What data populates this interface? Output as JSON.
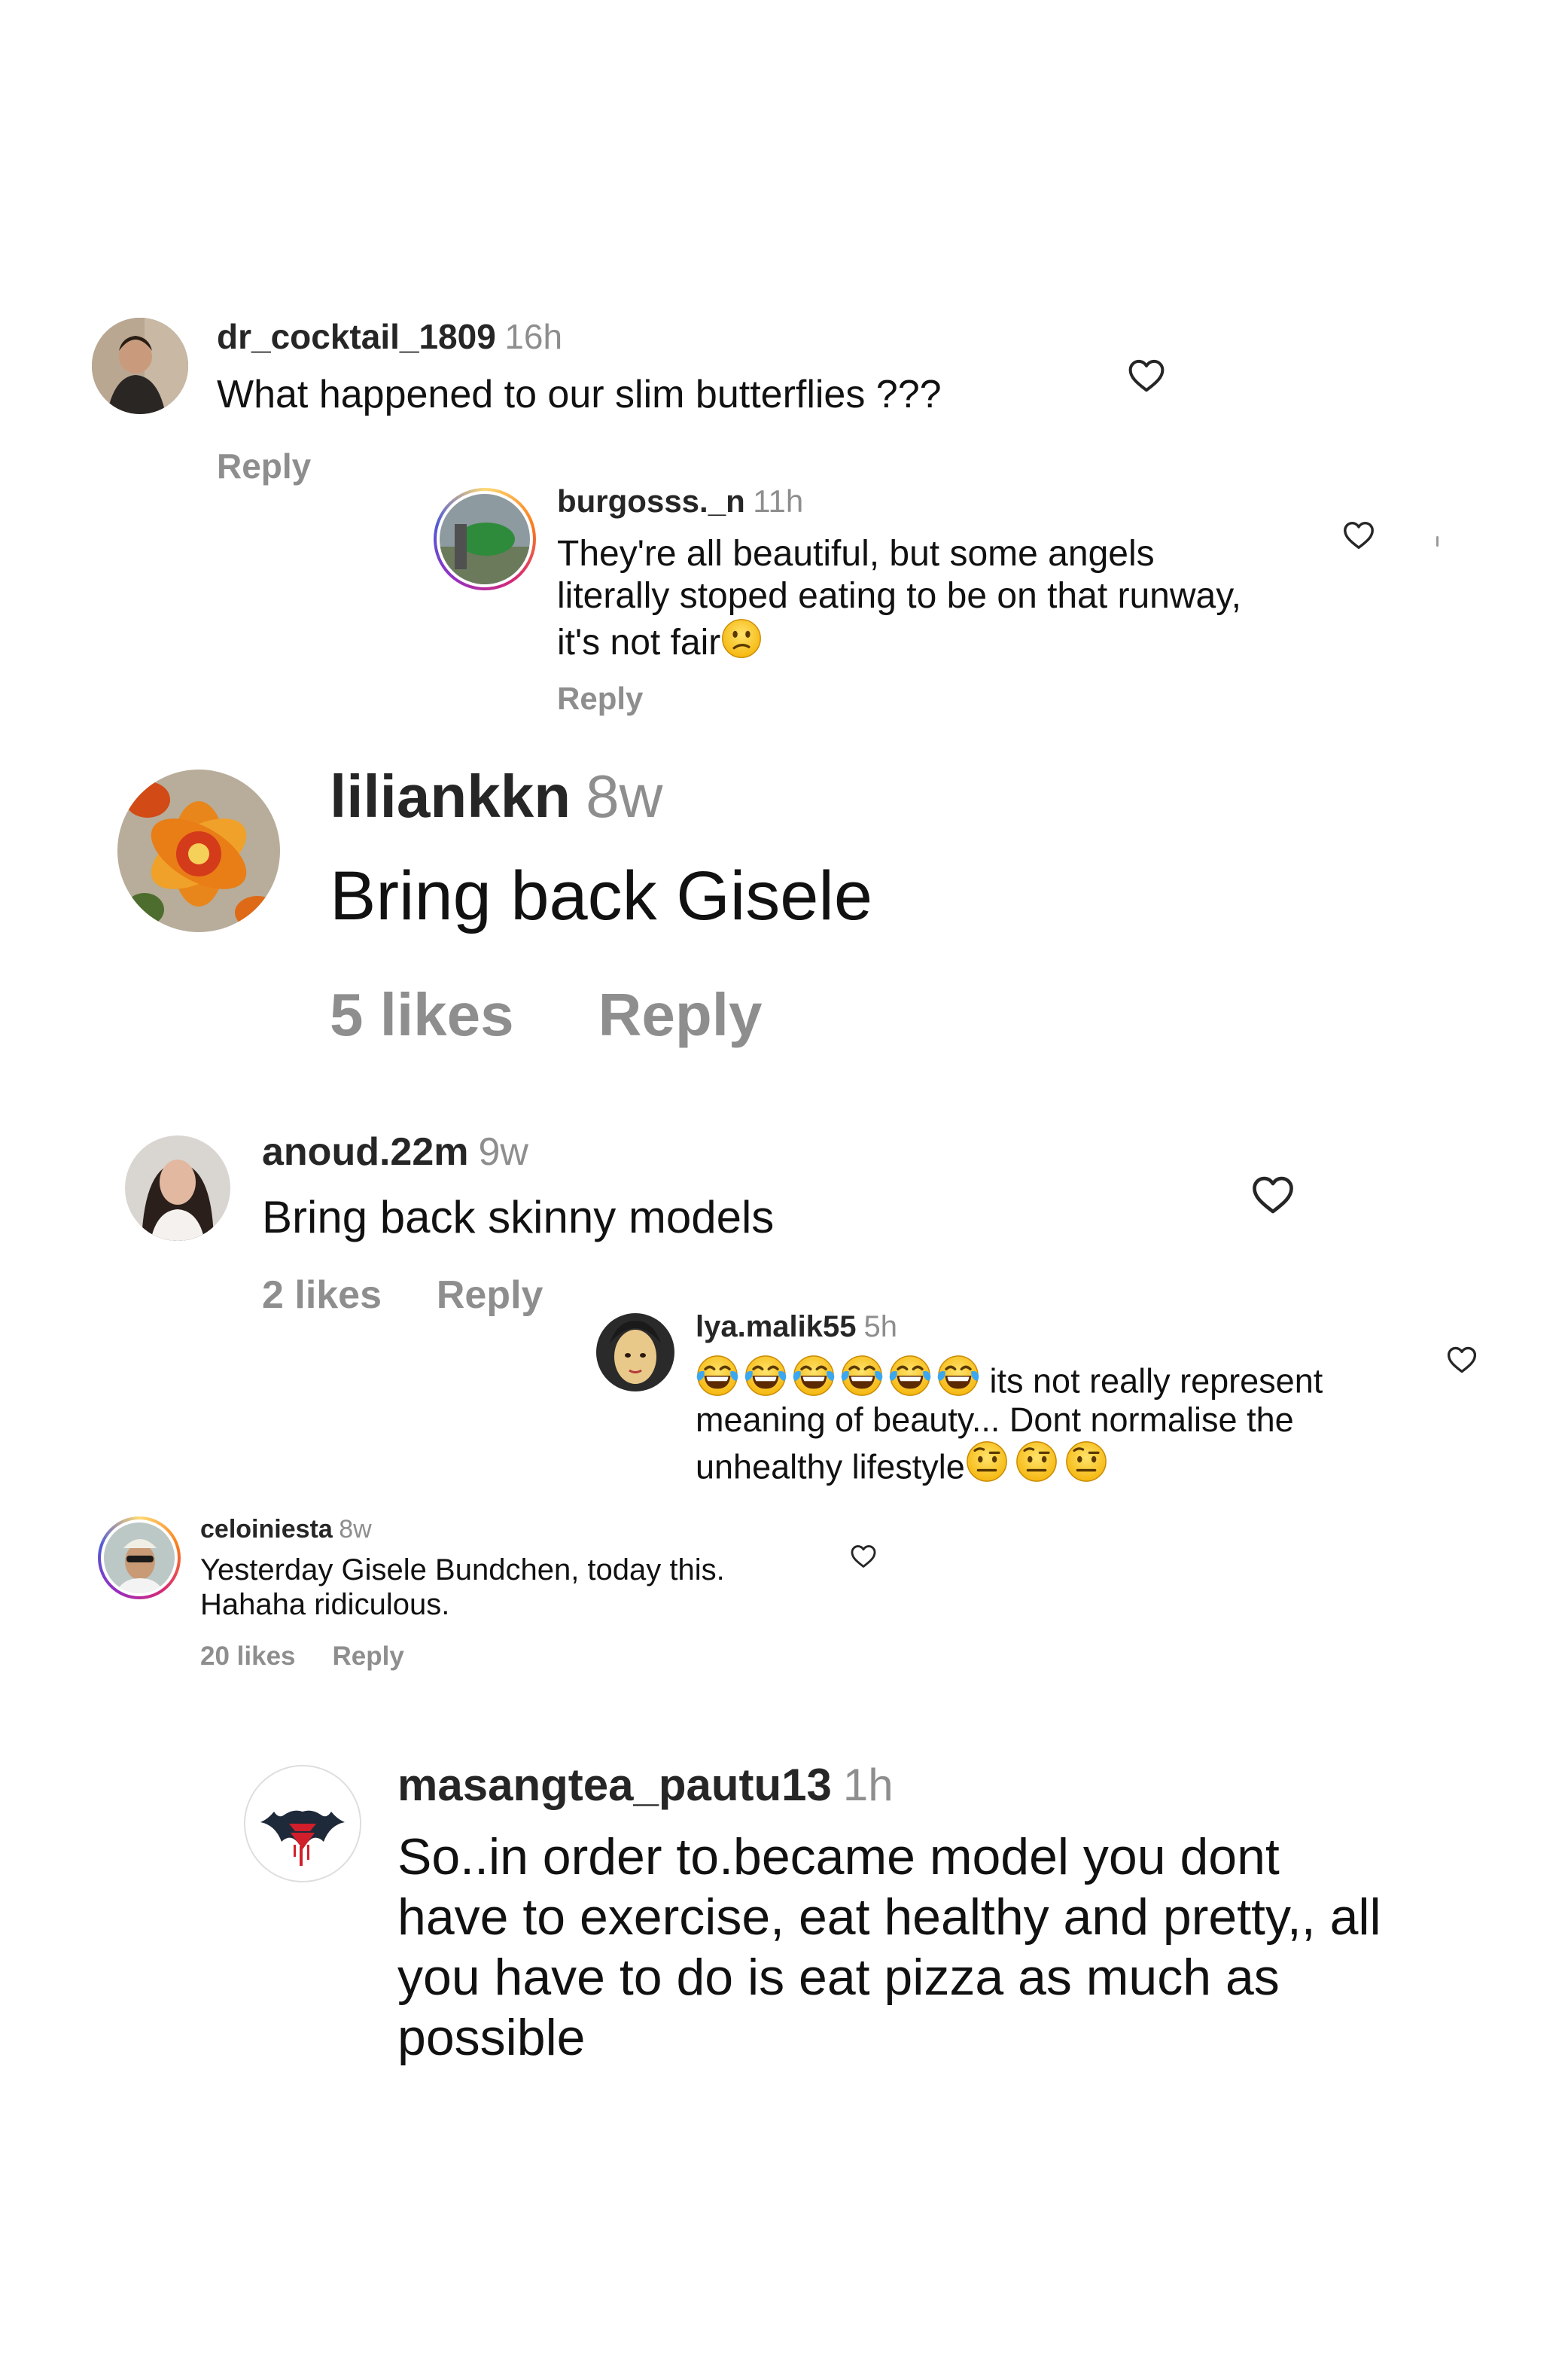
{
  "comments": [
    {
      "username": "dr_cocktail_1809",
      "time": "16h",
      "text": "What happened to our slim butterflies ???",
      "reply": "Reply"
    },
    {
      "username": "burgosss._n",
      "time": "11h",
      "text_lines": [
        "They're all beautiful, but some angels",
        "literally stoped eating to be on that runway,",
        "it's not fair"
      ],
      "emoji": "confused-face",
      "reply": "Reply"
    },
    {
      "username": "liliankkn",
      "time": "8w",
      "text": "Bring back Gisele",
      "likes": "5 likes",
      "reply": "Reply"
    },
    {
      "username": "anoud.22m",
      "time": "9w",
      "text": "Bring back skinny models",
      "likes": "2 likes",
      "reply": "Reply"
    },
    {
      "username": "lya.malik55",
      "time": "5h",
      "text_lines": [
        "its not really represent",
        "meaning of beauty... Dont normalise the",
        "unhealthy lifestyle"
      ],
      "emoji_lead": "laughing-tears-face x6",
      "emoji_trail": "raised-eyebrow-face x3"
    },
    {
      "username": "celoiniesta",
      "time": "8w",
      "text_lines": [
        "Yesterday Gisele Bundchen, today this.",
        "Hahaha ridiculous."
      ],
      "likes": "20 likes",
      "reply": "Reply"
    },
    {
      "username": "masangtea_pautu13",
      "time": "1h",
      "text_lines": [
        "So..in order to.became model you dont",
        "have to exercise, eat healthy and pretty,, all",
        "you have to do is eat pizza as much as",
        "possible"
      ]
    }
  ],
  "icons": {
    "like": "heart-outline-icon"
  },
  "colors": {
    "username": "#262626",
    "secondary": "#8e8e8e",
    "text": "#111111"
  }
}
